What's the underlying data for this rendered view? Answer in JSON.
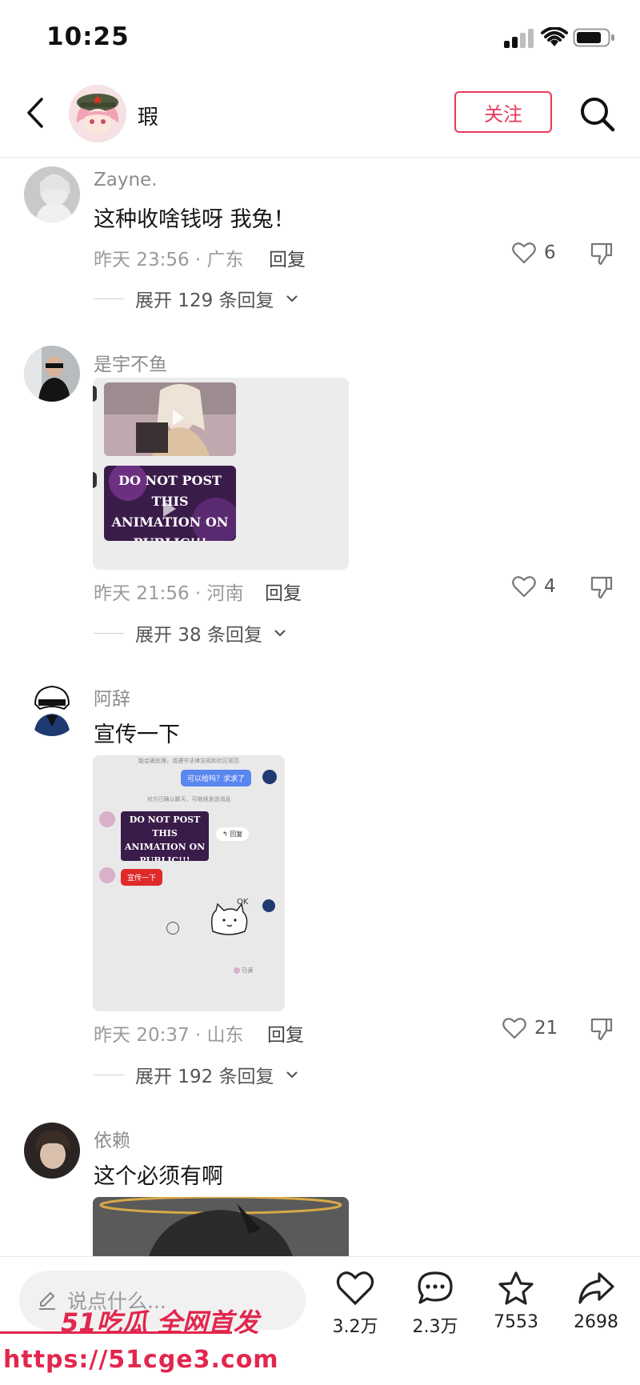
{
  "status_bar": {
    "time": "10:25"
  },
  "header": {
    "username": "瑕",
    "follow_label": "关注"
  },
  "comments": [
    {
      "username": "Zayne.",
      "text": "这种收啥钱呀 我兔！",
      "time_location": "昨天 23:56 · 广东",
      "reply_label": "回复",
      "likes": "6",
      "expand_label": "展开 129 条回复"
    },
    {
      "username": "是宇不鱼",
      "time_location": "昨天 21:56 · 河南",
      "reply_label": "回复",
      "likes": "4",
      "expand_label": "展开 38 条回复",
      "overlay_text": "DO NOT POST THIS ANIMATION ON PUBLIC!!!"
    },
    {
      "username": "阿辞",
      "text": "宣传一下",
      "time_location": "昨天 20:37 · 山东",
      "reply_label": "回复",
      "likes": "21",
      "expand_label": "展开 192 条回复",
      "screenshot": {
        "notice": "能会被处理，请遵守法律法规和社区规范",
        "bubble_right": "可以给吗？求求了",
        "system_note": "对方已确认聊天，可继续发送消息",
        "overlay_text": "DO NOT POST THIS ANIMATION ON PUBLIC!!!",
        "reply_chip": "回复",
        "bubble_red": "宣传一下",
        "ok_text": "OK",
        "read_label": "已读"
      }
    },
    {
      "username": "依赖",
      "text": "这个必须有啊"
    }
  ],
  "bottom_bar": {
    "input_placeholder": "说点什么...",
    "like_count": "3.2万",
    "comment_count": "2.3万",
    "favorite_count": "7553",
    "share_count": "2698"
  },
  "watermark": {
    "line1": "51吃瓜 全网首发",
    "line2": "https://51cge3.com"
  },
  "colors": {
    "accent": "#e8385a",
    "watermark": "#e2264d"
  }
}
